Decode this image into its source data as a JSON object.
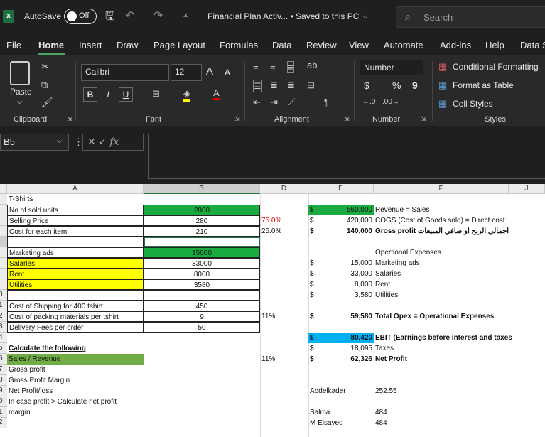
{
  "titlebar": {
    "autosave_label": "AutoSave",
    "autosave_state": "Off",
    "doc_title": "Financial Plan Activ... • Saved to this PC",
    "search_placeholder": "Search"
  },
  "menu": [
    "File",
    "Home",
    "Insert",
    "Draw",
    "Page Layout",
    "Formulas",
    "Data",
    "Review",
    "View",
    "Automate",
    "Add-ins",
    "Help",
    "Data S"
  ],
  "ribbon": {
    "paste_label": "Paste",
    "clipboard_label": "Clipboard",
    "font_name": "Calibri",
    "font_size": "12",
    "font_label": "Font",
    "alignment_label": "Alignment",
    "number_format": "Number",
    "number_label": "Number",
    "conditional_formatting": "Conditional Formatting",
    "format_as_table": "Format as Table",
    "cell_styles": "Cell Styles",
    "styles_label": "Styles",
    "bold": "B",
    "italic": "I",
    "underline": "U",
    "grow_font": "A",
    "shrink_font": "A",
    "currency": "$",
    "percent": "%",
    "comma": "9",
    "fx": "fx"
  },
  "formula_bar": {
    "name_box": "B5",
    "formula": ""
  },
  "columns": [
    "A",
    "B",
    "D",
    "E",
    "F",
    "J"
  ],
  "row_headers": [
    "",
    "",
    "",
    "",
    "",
    "",
    "",
    "",
    "",
    "0",
    "1",
    "2",
    "3",
    "4",
    "5",
    "6",
    "7",
    "8",
    "9",
    "0",
    "1",
    "2"
  ],
  "cells": {
    "a1": "T-Shirts",
    "a2": "No of sold units",
    "a3": "Selling Price",
    "a4": "Cost for each item",
    "a6": "Marketing ads",
    "a7": "Salaries",
    "a8": "Rent",
    "a9": "Utilities",
    "a11": "Cost of Shipping for 400 tshirt",
    "a12": "Cost of packing materials per tshirt",
    "a13": "Delivery Fees per order",
    "a15": "Calculate the following",
    "a16": "Sales / Revenue",
    "a17": "Gross profit",
    "a18": "Gross Profit Margin",
    "a19": "Net Profit/loss",
    "a20": "In case profit > Calculate net profit",
    "a21": "margin",
    "b2": "2000",
    "b3": "280",
    "b4": "210",
    "b6": "15000",
    "b7": "33000",
    "b8": "8000",
    "b9": "3580",
    "b11": "450",
    "b12": "9",
    "b13": "50",
    "d3": "75.0%",
    "d4": "25.0%",
    "d12": "11%",
    "d16": "11%",
    "cur": "$",
    "e2": "560,000",
    "e3": "420,000",
    "e4": "140,000",
    "e7": "15,000",
    "e8": "33,000",
    "e9": "8,000",
    "e10": "3,580",
    "e12": "59,580",
    "e14": "80,420",
    "e15": "18,095",
    "e16": "62,326",
    "e19": "Abdelkader",
    "e21": "Salma",
    "e22": "M Elsayed",
    "f2": "Revenue = Sales",
    "f3": "COGS (Cost of Goods sold) = Direct cost",
    "f4": "Gross profit اجمالي الربح او صافي المبيعات",
    "f6": "Opertional Expenses",
    "f7": "Marketing ads",
    "f8": "Salaries",
    "f9": "Rent",
    "f10": "Utilities",
    "f12": "Total Opex = Operational Expenses",
    "f14": "EBIT (Earnings before interest and taxes",
    "f15": "Taxes",
    "f16": "Net Profit",
    "f19": "252.55",
    "f21": "484",
    "f22": "484"
  },
  "colors": {
    "green_fill": "#1aab40",
    "yellow_fill": "#ffff00",
    "olive_fill": "#70ad47",
    "blue_fill": "#00b0f0",
    "excel_green": "#217346"
  }
}
